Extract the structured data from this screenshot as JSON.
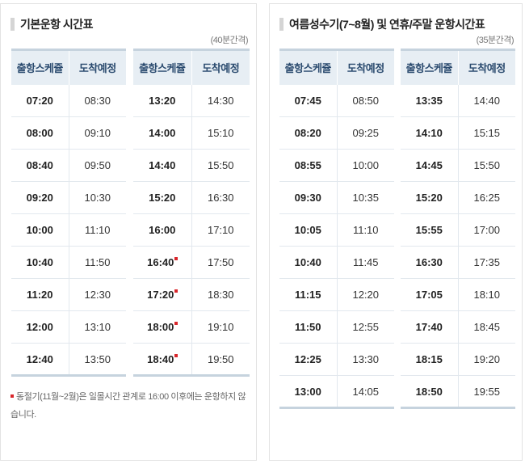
{
  "left": {
    "title": "기본운항 시간표",
    "interval": "(40분간격)",
    "headers": [
      "출항스케쥴",
      "도착예정"
    ],
    "table1": [
      {
        "dep": "07:20",
        "arr": "08:30",
        "winter": false
      },
      {
        "dep": "08:00",
        "arr": "09:10",
        "winter": false
      },
      {
        "dep": "08:40",
        "arr": "09:50",
        "winter": false
      },
      {
        "dep": "09:20",
        "arr": "10:30",
        "winter": false
      },
      {
        "dep": "10:00",
        "arr": "11:10",
        "winter": false
      },
      {
        "dep": "10:40",
        "arr": "11:50",
        "winter": false
      },
      {
        "dep": "11:20",
        "arr": "12:30",
        "winter": false
      },
      {
        "dep": "12:00",
        "arr": "13:10",
        "winter": false
      },
      {
        "dep": "12:40",
        "arr": "13:50",
        "winter": false
      }
    ],
    "table2": [
      {
        "dep": "13:20",
        "arr": "14:30",
        "winter": false
      },
      {
        "dep": "14:00",
        "arr": "15:10",
        "winter": false
      },
      {
        "dep": "14:40",
        "arr": "15:50",
        "winter": false
      },
      {
        "dep": "15:20",
        "arr": "16:30",
        "winter": false
      },
      {
        "dep": "16:00",
        "arr": "17:10",
        "winter": false
      },
      {
        "dep": "16:40",
        "arr": "17:50",
        "winter": true
      },
      {
        "dep": "17:20",
        "arr": "18:30",
        "winter": true
      },
      {
        "dep": "18:00",
        "arr": "19:10",
        "winter": true
      },
      {
        "dep": "18:40",
        "arr": "19:50",
        "winter": true
      }
    ],
    "note": "동절기(11월~2월)은 일몰시간 관계로 16:00 이후에는 운항하지 않습니다."
  },
  "right": {
    "title": "여름성수기(7~8월) 및 연휴/주말 운항시간표",
    "interval": "(35분간격)",
    "headers": [
      "출항스케쥴",
      "도착예정"
    ],
    "table1": [
      {
        "dep": "07:45",
        "arr": "08:50"
      },
      {
        "dep": "08:20",
        "arr": "09:25"
      },
      {
        "dep": "08:55",
        "arr": "10:00"
      },
      {
        "dep": "09:30",
        "arr": "10:35"
      },
      {
        "dep": "10:05",
        "arr": "11:10"
      },
      {
        "dep": "10:40",
        "arr": "11:45"
      },
      {
        "dep": "11:15",
        "arr": "12:20"
      },
      {
        "dep": "11:50",
        "arr": "12:55"
      },
      {
        "dep": "12:25",
        "arr": "13:30"
      },
      {
        "dep": "13:00",
        "arr": "14:05"
      }
    ],
    "table2": [
      {
        "dep": "13:35",
        "arr": "14:40"
      },
      {
        "dep": "14:10",
        "arr": "15:15"
      },
      {
        "dep": "14:45",
        "arr": "15:50"
      },
      {
        "dep": "15:20",
        "arr": "16:25"
      },
      {
        "dep": "15:55",
        "arr": "17:00"
      },
      {
        "dep": "16:30",
        "arr": "17:35"
      },
      {
        "dep": "17:05",
        "arr": "18:10"
      },
      {
        "dep": "17:40",
        "arr": "18:45"
      },
      {
        "dep": "18:15",
        "arr": "19:20"
      },
      {
        "dep": "18:50",
        "arr": "19:55"
      }
    ]
  }
}
